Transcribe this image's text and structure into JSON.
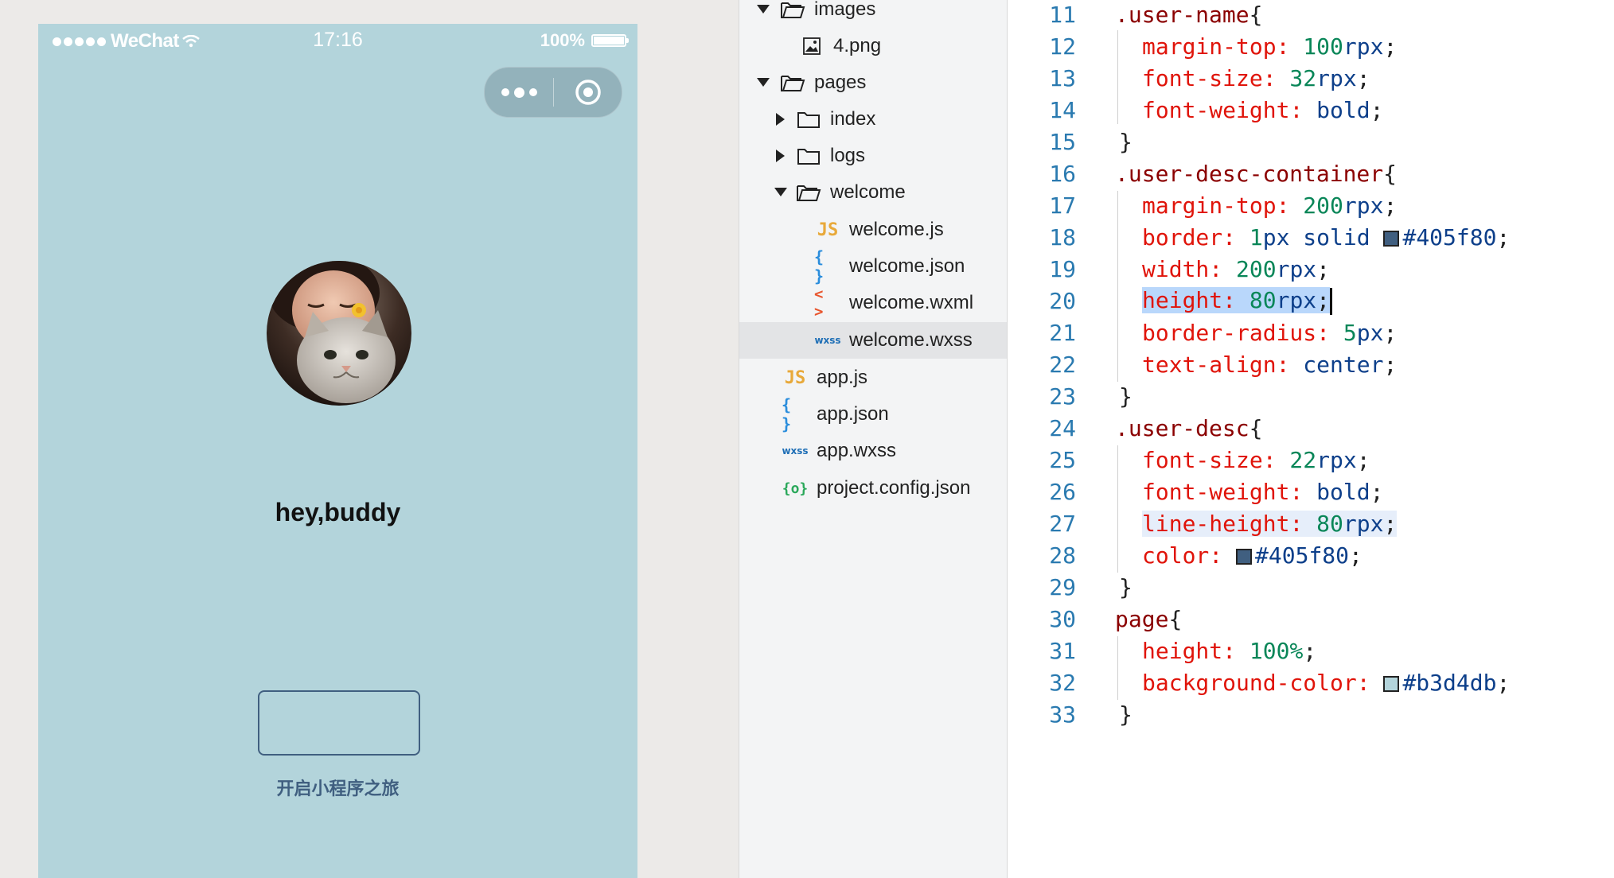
{
  "simulator": {
    "status_bar": {
      "carrier": "WeChat",
      "time": "17:16",
      "battery": "100%"
    },
    "user_name": "hey,buddy",
    "user_desc": "开启小程序之旅"
  },
  "file_tree": {
    "rows": [
      {
        "label": "images"
      },
      {
        "label": "4.png"
      },
      {
        "label": "pages"
      },
      {
        "label": "index"
      },
      {
        "label": "logs"
      },
      {
        "label": "welcome"
      },
      {
        "label": "welcome.js"
      },
      {
        "label": "welcome.json"
      },
      {
        "label": "welcome.wxml"
      },
      {
        "label": "welcome.wxss"
      },
      {
        "label": "app.js"
      },
      {
        "label": "app.json"
      },
      {
        "label": "app.wxss"
      },
      {
        "label": "project.config.json"
      }
    ],
    "icons": {
      "js": "JS",
      "json": "{ }",
      "wxml": "< >",
      "wxss": "wxss",
      "config": "{o}"
    },
    "selected": "welcome.wxss"
  },
  "editor": {
    "line_numbers": [
      "11",
      "12",
      "13",
      "14",
      "15",
      "16",
      "17",
      "18",
      "19",
      "20",
      "21",
      "22",
      "23",
      "24",
      "25",
      "26",
      "27",
      "28",
      "29",
      "30",
      "31",
      "32",
      "33"
    ],
    "tokens": {
      "l11": [
        ".user-name",
        "{"
      ],
      "l12": [
        "margin-top",
        ":",
        " 100",
        "rpx",
        ";"
      ],
      "l13": [
        "font-size",
        ":",
        " 32",
        "rpx",
        ";"
      ],
      "l14": [
        "font-weight",
        ":",
        " bold",
        ";"
      ],
      "l15": [
        "}"
      ],
      "l16": [
        ".user-desc-container",
        "{"
      ],
      "l17": [
        "margin-top",
        ":",
        " 200",
        "rpx",
        ";"
      ],
      "l18": [
        "border",
        ":",
        " 1",
        "px",
        " solid ",
        "#405f80",
        ";"
      ],
      "l19": [
        "width",
        ":",
        " 200",
        "rpx",
        ";"
      ],
      "l20": [
        "height",
        ":",
        " 80",
        "rpx",
        ";"
      ],
      "l21": [
        "border-radius",
        ":",
        " 5",
        "px",
        ";"
      ],
      "l22": [
        "text-align",
        ":",
        " center",
        ";"
      ],
      "l23": [
        "}"
      ],
      "l24": [
        ".user-desc",
        "{"
      ],
      "l25": [
        "font-size",
        ":",
        " 22",
        "rpx",
        ";"
      ],
      "l26": [
        "font-weight",
        ":",
        " bold",
        ";"
      ],
      "l27": [
        "line-height",
        ":",
        " 80",
        "rpx",
        ";"
      ],
      "l28": [
        "color",
        ":",
        " ",
        "#405f80",
        ";"
      ],
      "l29": [
        "}"
      ],
      "l30": [
        "page",
        "{"
      ],
      "l31": [
        "height",
        ":",
        " 100",
        "%",
        ";"
      ],
      "l32": [
        "background-color",
        ":",
        " ",
        "#b3d4db",
        ";"
      ],
      "l33": [
        "}"
      ]
    }
  },
  "colors": {
    "page_background": "#b3d4db",
    "accent": "#405f80",
    "line_number": "#2a7ab0",
    "property": "#e0140a",
    "number": "#098658",
    "selection": "#b9d7fb"
  }
}
